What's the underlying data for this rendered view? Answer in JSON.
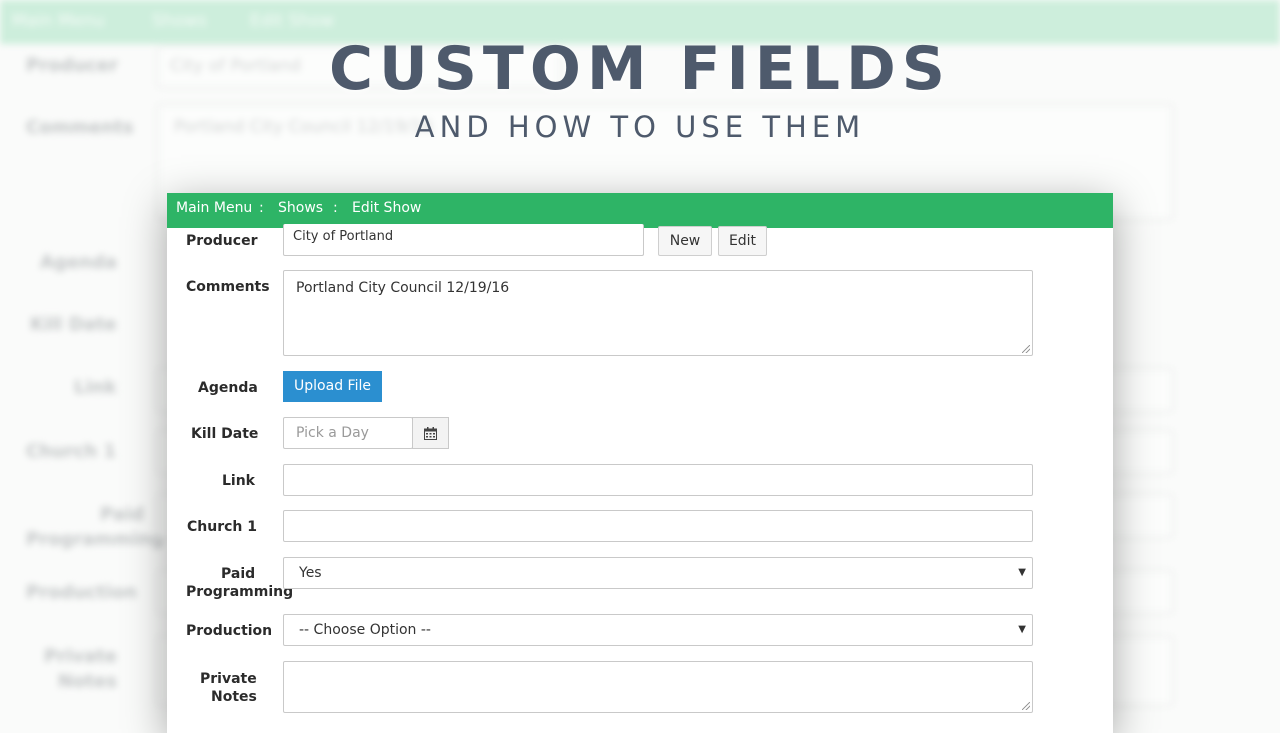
{
  "overlay": {
    "title": "CUSTOM FIELDS",
    "subtitle": "AND HOW TO USE THEM"
  },
  "breadcrumb": {
    "items": [
      "Main Menu",
      "Shows",
      "Edit Show"
    ],
    "separator": ":"
  },
  "form": {
    "producer": {
      "label": "Producer",
      "value": "City of Portland",
      "new_label": "New",
      "edit_label": "Edit"
    },
    "comments": {
      "label": "Comments",
      "value": "Portland City Council 12/19/16"
    },
    "agenda": {
      "label": "Agenda",
      "button_label": "Upload File"
    },
    "kill_date": {
      "label": "Kill Date",
      "placeholder": "Pick a Day",
      "icon": "calendar-icon"
    },
    "link": {
      "label": "Link",
      "value": ""
    },
    "church1": {
      "label": "Church 1",
      "value": ""
    },
    "paid_programming": {
      "label_line1": "Paid",
      "label_line2": "Programming",
      "value": "Yes"
    },
    "production": {
      "label": "Production",
      "value": "-- Choose Option --"
    },
    "private_notes": {
      "label_line1": "Private",
      "label_line2": "Notes",
      "value": ""
    }
  },
  "background": {
    "producer_value": "City of Portland",
    "comments_value": "Portland City Council 12/19/16"
  },
  "colors": {
    "navbar": "#2eb466",
    "upload_button": "#2b8fd0",
    "title_text": "#4e5a6c"
  }
}
